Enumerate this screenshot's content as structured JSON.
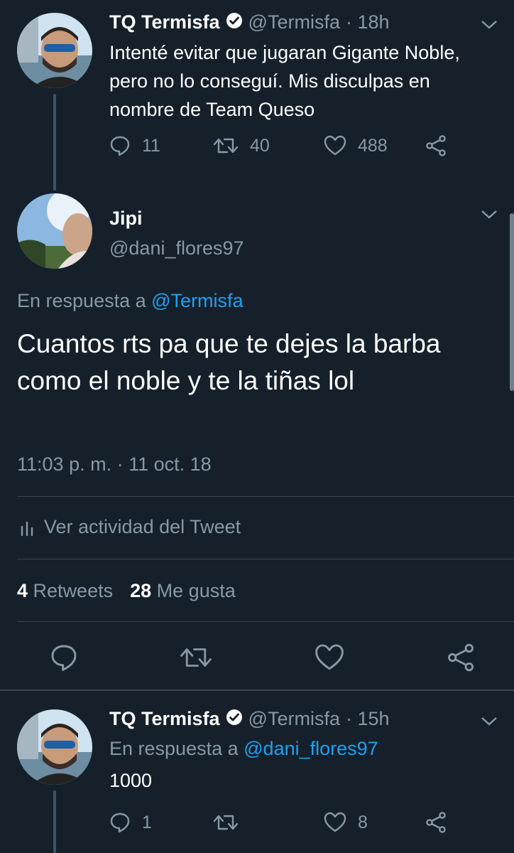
{
  "tweet1": {
    "name": "TQ Termisfa",
    "handle": "@Termisfa",
    "time": "· 18h",
    "text": "Intenté evitar que jugaran Gigante Noble, pero no lo conseguí. Mis disculpas en nombre de Team Queso",
    "replies": "11",
    "retweets": "40",
    "likes": "488"
  },
  "main": {
    "name": "Jipi",
    "handle": "@dani_flores97",
    "reply_prefix": "En respuesta a",
    "reply_to": "@Termisfa",
    "text": "Cuantos rts pa que te dejes la barba como el noble y te la tiñas lol",
    "timestamp": "11:03 p. m. · 11 oct. 18",
    "activity_label": "Ver actividad del Tweet",
    "retweets_count": "4",
    "retweets_label": "Retweets",
    "likes_count": "28",
    "likes_label": "Me gusta"
  },
  "tweet3": {
    "name": "TQ Termisfa",
    "handle": "@Termisfa",
    "time": "· 15h",
    "reply_prefix": "En respuesta a",
    "reply_to": "@dani_flores97",
    "text": "1000",
    "replies": "1",
    "retweets": "",
    "likes": "8"
  },
  "colors": {
    "background": "#15202b",
    "muted": "#8899a6",
    "link": "#1da1f2",
    "divider": "#38444d"
  }
}
